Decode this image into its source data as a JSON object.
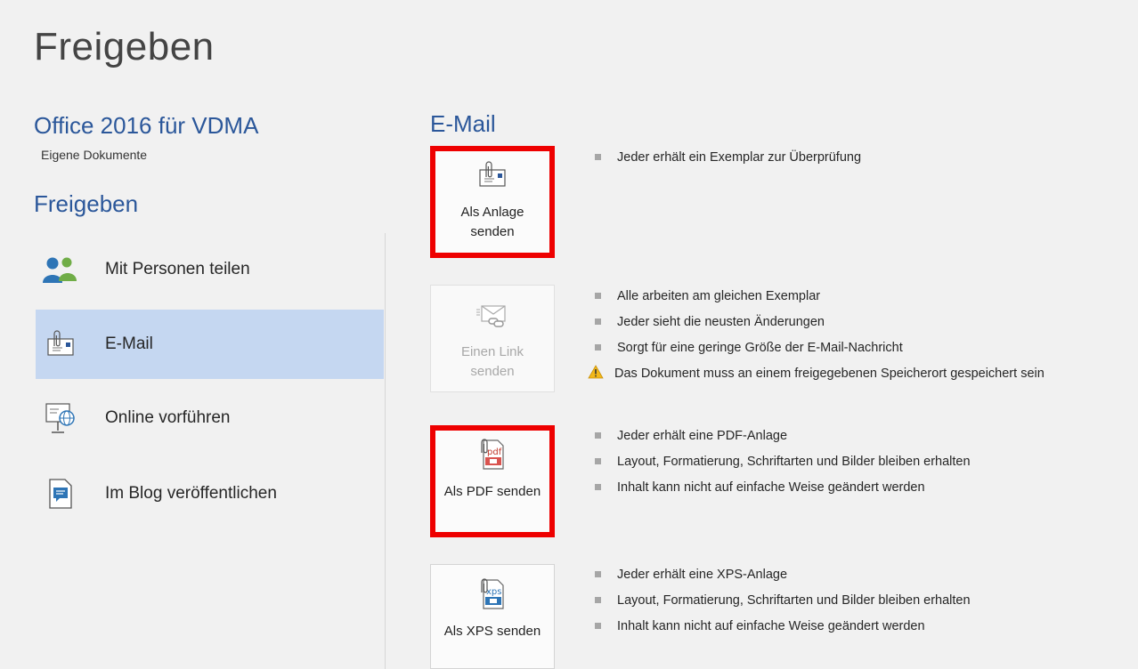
{
  "page": {
    "title": "Freigeben"
  },
  "document": {
    "title": "Office 2016 für VDMA",
    "location": "Eigene Dokumente"
  },
  "left": {
    "section_title": "Freigeben",
    "items": [
      {
        "label": "Mit Personen teilen",
        "icon": "people-icon",
        "selected": false
      },
      {
        "label": "E-Mail",
        "icon": "email-attachment-icon",
        "selected": true
      },
      {
        "label": "Online vorführen",
        "icon": "present-online-icon",
        "selected": false
      },
      {
        "label": "Im Blog veröffentlichen",
        "icon": "blog-icon",
        "selected": false
      }
    ]
  },
  "right": {
    "section_title": "E-Mail",
    "actions": [
      {
        "label": "Als Anlage senden",
        "icon": "email-attachment-icon",
        "highlighted": true,
        "enabled": true,
        "bullets": [
          "Jeder erhält ein Exemplar zur Überprüfung"
        ]
      },
      {
        "label": "Einen Link senden",
        "icon": "email-link-icon",
        "highlighted": false,
        "enabled": false,
        "bullets": [
          "Alle arbeiten am gleichen Exemplar",
          "Jeder sieht die neusten Änderungen",
          "Sorgt für eine geringe Größe der E-Mail-Nachricht"
        ],
        "warning": "Das Dokument muss an einem freigegebenen Speicherort gespeichert sein"
      },
      {
        "label": "Als PDF senden",
        "icon": "pdf-attachment-icon",
        "highlighted": true,
        "enabled": true,
        "bullets": [
          "Jeder erhält eine PDF-Anlage",
          "Layout, Formatierung, Schriftarten und Bilder bleiben erhalten",
          "Inhalt kann nicht auf einfache Weise geändert werden"
        ]
      },
      {
        "label": "Als XPS senden",
        "icon": "xps-attachment-icon",
        "highlighted": false,
        "enabled": true,
        "bullets": [
          "Jeder erhält eine XPS-Anlage",
          "Layout, Formatierung, Schriftarten und Bilder bleiben erhalten",
          "Inhalt kann nicht auf einfache Weise geändert werden"
        ]
      }
    ]
  },
  "colors": {
    "accent": "#2b579a",
    "selected": "#c5d7f1",
    "highlight_border": "#ee0000",
    "background": "#f1f1f1"
  }
}
